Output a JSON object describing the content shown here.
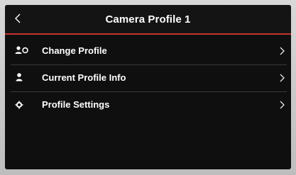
{
  "header": {
    "title": "Camera Profile 1",
    "back_icon": "chevron-left-icon",
    "accent_color": "#c8322a"
  },
  "menu": {
    "items": [
      {
        "label": "Change Profile",
        "icon": "users-switch-icon"
      },
      {
        "label": "Current Profile Info",
        "icon": "user-icon"
      },
      {
        "label": "Profile Settings",
        "icon": "gear-icon"
      }
    ],
    "chevron_icon": "chevron-right-icon"
  }
}
